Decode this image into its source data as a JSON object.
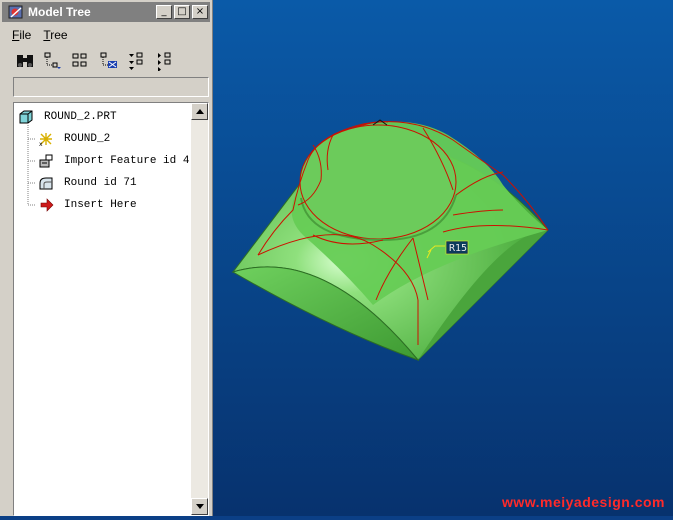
{
  "window": {
    "title": "Model Tree",
    "controls": {
      "minimize": "_",
      "maximize": "□",
      "close": "×"
    }
  },
  "menu": {
    "file": {
      "accel": "F",
      "rest": "ile"
    },
    "tree": {
      "accel": "T",
      "rest": "ree"
    }
  },
  "toolbar": {
    "icons": [
      "find-binoculars-icon",
      "tree-expand-icon",
      "tree-columns-icon",
      "tree-filter-icon",
      "tree-settings-icon",
      "tree-collapse-icon"
    ]
  },
  "tree": {
    "root": "ROUND_2.PRT",
    "items": [
      {
        "label": "ROUND_2",
        "icon": "datum-csys-icon"
      },
      {
        "label": "Import Feature id 4",
        "icon": "import-feature-icon"
      },
      {
        "label": "Round id 71",
        "icon": "round-feature-icon"
      },
      {
        "label": "Insert Here",
        "icon": "insert-arrow-icon"
      }
    ]
  },
  "viewport": {
    "dimension_label": "R15",
    "watermark": "www.meiyadesign.com",
    "colors": {
      "background_top": "#0a5aa8",
      "background_bottom": "#07326e",
      "model": "#66cc55",
      "edges": "#cc1100"
    }
  }
}
